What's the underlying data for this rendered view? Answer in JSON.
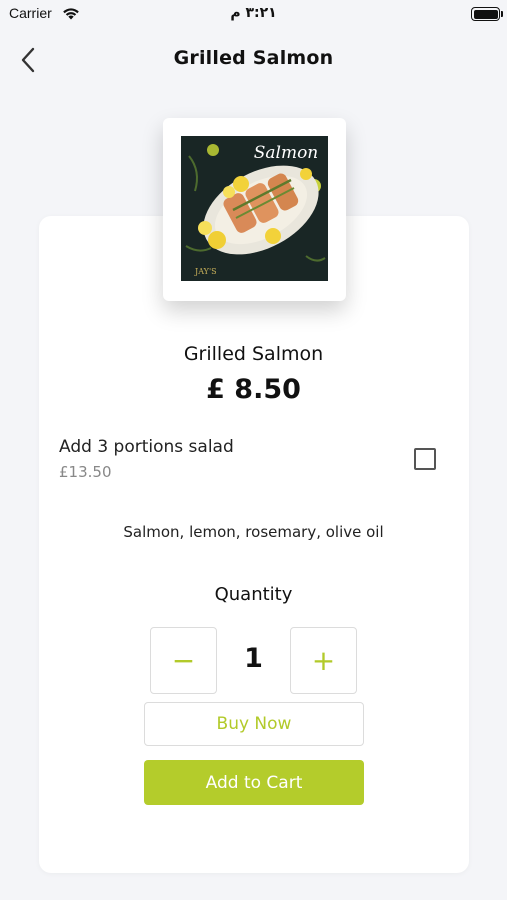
{
  "status_bar": {
    "carrier": "Carrier",
    "time": "٣:٢١ م"
  },
  "nav": {
    "title": "Grilled Salmon",
    "back_icon": "chevron-left-icon"
  },
  "product": {
    "image_icon": "salmon-dish-image",
    "image_caption": "Salmon",
    "name": "Grilled Salmon",
    "price": "£ 8.50",
    "addon": {
      "label": "Add 3 portions salad",
      "price": "£13.50",
      "checked": false
    },
    "ingredients": "Salmon, lemon, rosemary, olive oil"
  },
  "quantity": {
    "label": "Quantity",
    "value": "1",
    "minus": "−",
    "plus": "+"
  },
  "actions": {
    "buy_now": "Buy Now",
    "add_to_cart": "Add to Cart"
  },
  "colors": {
    "accent": "#b4cc2b",
    "background": "#f4f5f8"
  }
}
